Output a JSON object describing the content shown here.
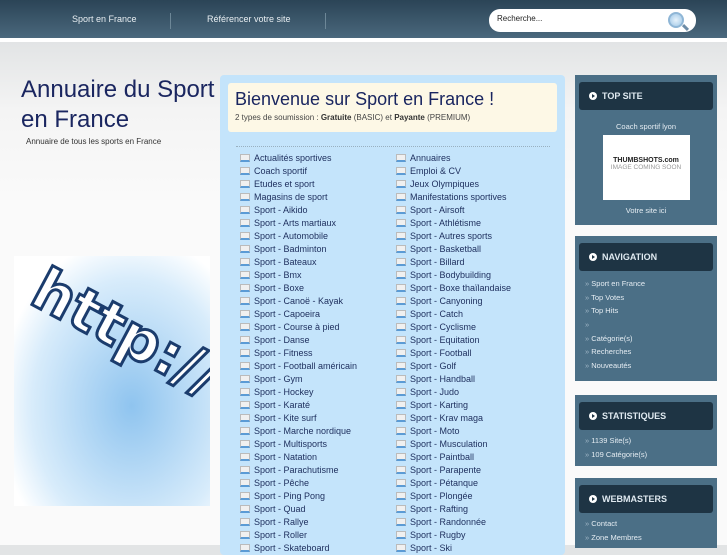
{
  "header": {
    "nav": [
      "Sport en France",
      "Référencer votre site"
    ],
    "search_placeholder": "Recherche..."
  },
  "site": {
    "title": "Annuaire du Sport en France",
    "subtitle": "Annuaire de tous les sports en France",
    "banner_text": "http://w"
  },
  "welcome": {
    "title": "Bienvenue sur Sport en France !",
    "intro": "2 types de soumission : ",
    "free": "Gratuite",
    "free_type": " (BASIC) et ",
    "paid": "Payante",
    "paid_type": " (PREMIUM)"
  },
  "categories": {
    "left": [
      "Actualités sportives",
      "Coach sportif",
      "Etudes et sport",
      "Magasins de sport",
      "Sport - Aikido",
      "Sport - Arts martiaux",
      "Sport - Automobile",
      "Sport - Badminton",
      "Sport - Bateaux",
      "Sport - Bmx",
      "Sport - Boxe",
      "Sport - Canoë - Kayak",
      "Sport - Capoeira",
      "Sport - Course à pied",
      "Sport - Danse",
      "Sport - Fitness",
      "Sport - Football américain",
      "Sport - Gym",
      "Sport - Hockey",
      "Sport - Karaté",
      "Sport - Kite surf",
      "Sport - Marche nordique",
      "Sport - Multisports",
      "Sport - Natation",
      "Sport - Parachutisme",
      "Sport - Pêche",
      "Sport - Ping Pong",
      "Sport - Quad",
      "Sport - Rallye",
      "Sport - Roller",
      "Sport - Skateboard"
    ],
    "right": [
      "Annuaires",
      "Emploi & CV",
      "Jeux Olympiques",
      "Manifestations sportives",
      "Sport - Airsoft",
      "Sport - Athlétisme",
      "Sport - Autres sports",
      "Sport - Basketball",
      "Sport - Billard",
      "Sport - Bodybuilding",
      "Sport - Boxe thaïlandaise",
      "Sport - Canyoning",
      "Sport - Catch",
      "Sport - Cyclisme",
      "Sport - Equitation",
      "Sport - Football",
      "Sport - Golf",
      "Sport - Handball",
      "Sport - Judo",
      "Sport - Karting",
      "Sport - Krav maga",
      "Sport - Moto",
      "Sport - Musculation",
      "Sport - Paintball",
      "Sport - Parapente",
      "Sport - Pétanque",
      "Sport - Plongée",
      "Sport - Rafting",
      "Sport - Randonnée",
      "Sport - Rugby",
      "Sport - Ski"
    ]
  },
  "sidebar": {
    "top_site": {
      "title": "TOP SITE",
      "site_name": "Coach sportif lyon",
      "thumb_brand": "THUMBSHOTS.com",
      "thumb_text": "IMAGE COMING SOON",
      "cta": "Votre site ici"
    },
    "navigation": {
      "title": "NAVIGATION",
      "items": [
        "Sport en France",
        "Top Votes",
        "Top Hits",
        "",
        "Catégorie(s)",
        "Recherches",
        "Nouveautés"
      ]
    },
    "stats": {
      "title": "STATISTIQUES",
      "items": [
        "1139 Site(s)",
        "109 Catégorie(s)"
      ]
    },
    "webmasters": {
      "title": "WEBMASTERS",
      "items": [
        "Contact",
        "Zone Membres"
      ]
    }
  }
}
